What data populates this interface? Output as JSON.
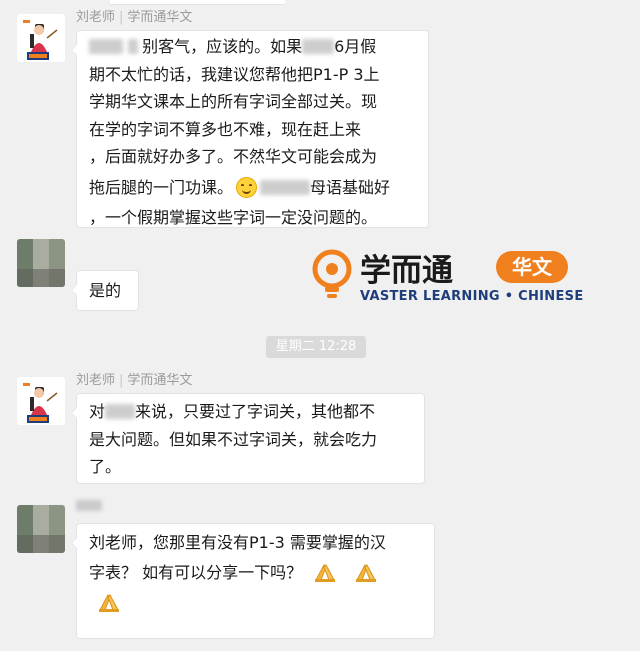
{
  "messages": [
    {
      "sender": {
        "name": "刘老师",
        "org": "学而通华文"
      },
      "lines": [
        {
          "pre": "",
          "post": "别客气，应该的。如果",
          "tail": "6月假"
        },
        "期不太忙的话，我建议您帮他把P1-P 3上",
        "学期华文课本上的所有字词全部过关。现",
        "在学的字词不算多也不难，现在赶上来",
        "，后面就好办多了。不然华文可能会成为",
        {
          "pre": "拖后腿的一门功课。",
          "post": "母语基础好"
        },
        "，一个假期掌握这些字词一定没问题的。"
      ]
    },
    {
      "text": "是的"
    },
    {
      "sender": {
        "name": "刘老师",
        "org": "学而通华文"
      },
      "lines": [
        {
          "pre": "对",
          "post": "来说，只要过了字词关，其他都不"
        },
        "是大问题。但如果不过字词关，就会吃力",
        "了。"
      ]
    },
    {
      "lines": [
        "刘老师，您那里有没有P1-3 需要掌握的汉",
        "字表？ 如有可以分享一下吗？"
      ]
    }
  ],
  "timestamp": "星期二 12:28",
  "logo": {
    "brand": "学而通",
    "badge": "华文",
    "tagline": "VASTER LEARNING • CHINESE"
  },
  "icons": {
    "smile": "smiling-face-emoji",
    "pray": "folded-hands-emoji"
  },
  "colors": {
    "background": "#f0f0f0",
    "bubble": "#ffffff",
    "sender": "#9b9b9b",
    "brand_orange": "#f07f1e",
    "brand_blue": "#1f3d7a"
  }
}
